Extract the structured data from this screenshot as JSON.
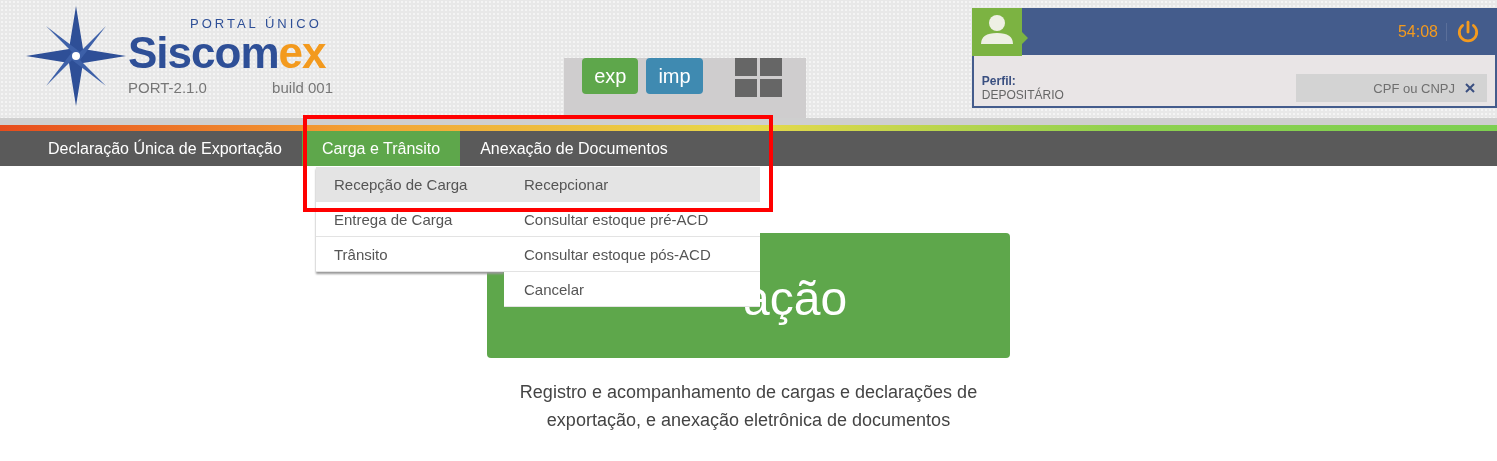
{
  "header": {
    "logo": {
      "tagline": "PORTAL ÚNICO",
      "brand": "Siscom**ex**",
      "version": "PORT-2.1.0",
      "build": "build 001"
    },
    "modules": [
      {
        "label": "exp",
        "kind": "export"
      },
      {
        "label": "imp",
        "kind": "import"
      }
    ],
    "user": {
      "timer": "54:08",
      "profile_label": "Perfil:",
      "profile": "DEPOSITÁRIO",
      "search": {
        "placeholder": "CPF ou CNPJ"
      }
    }
  },
  "nav": [
    {
      "label": "Declaração Única de Exportação",
      "selected": false
    },
    {
      "label": "Carga e Trânsito",
      "selected": true
    },
    {
      "label": "Anexação de Documentos",
      "selected": false
    }
  ],
  "dropdown": {
    "groups": [
      {
        "label": "Recepção de Carga",
        "selected": true
      },
      {
        "label": "Entrega de Carga",
        "selected": false
      },
      {
        "label": "Trânsito",
        "selected": false
      }
    ],
    "actions": [
      {
        "label": "Recepcionar",
        "selected": true
      },
      {
        "label": "Consultar estoque pré-ACD",
        "selected": false
      },
      {
        "label": "Consultar estoque pós-ACD",
        "selected": false
      },
      {
        "label": "Cancelar",
        "selected": false
      }
    ]
  },
  "card": {
    "title": "ação",
    "description": "Registro e acompanhamento de cargas e declarações de exportação, e anexação eletrônica de documentos"
  }
}
